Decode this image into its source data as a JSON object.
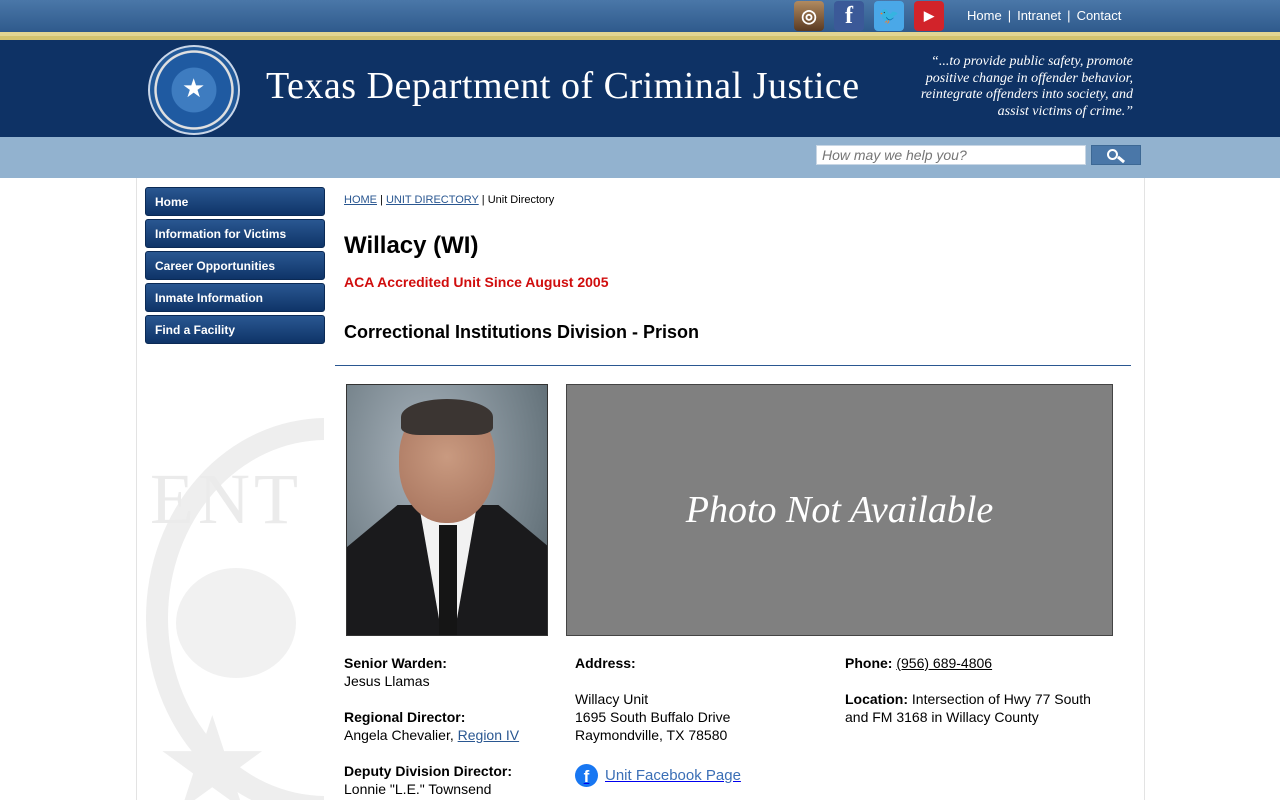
{
  "top": {
    "social": [
      {
        "name": "instagram-icon",
        "glyph": "◎"
      },
      {
        "name": "facebook-icon",
        "glyph": "f"
      },
      {
        "name": "twitter-icon",
        "glyph": "🐦"
      },
      {
        "name": "youtube-icon",
        "glyph": "▶"
      }
    ],
    "links": [
      "Home",
      "Intranet",
      "Contact"
    ]
  },
  "header": {
    "title": "Texas Department of Criminal Justice",
    "motto": "“...to provide public safety, promote positive change in offender behavior, reintegrate offenders into society, and assist victims of crime.”"
  },
  "search": {
    "placeholder": "How may we help you?"
  },
  "nav": [
    "Home",
    "Information for Victims",
    "Career Opportunities",
    "Inmate Information",
    "Find a Facility"
  ],
  "breadcrumb": {
    "home": "HOME",
    "directory": "UNIT DIRECTORY",
    "current": "Unit Directory"
  },
  "unit": {
    "name": "Willacy (WI)",
    "accreditation": "ACA Accredited Unit Since August 2005",
    "division": "Correctional Institutions Division - Prison",
    "photo_text": "Photo Not Available",
    "senior_warden_label": "Senior Warden:",
    "senior_warden": "Jesus Llamas",
    "regional_director_label": "Regional Director:",
    "regional_director": "Angela Chevalier,",
    "region_link": "Region IV",
    "deputy_label": "Deputy Division Director:",
    "deputy": "Lonnie \"L.E.\" Townsend",
    "address_label": "Address:",
    "address_line1": "Willacy Unit",
    "address_line2": "1695 South Buffalo Drive",
    "address_line3": "Raymondville, TX 78580",
    "facebook_link": "Unit Facebook Page",
    "phone_label": "Phone:",
    "phone": "(956) 689-4806",
    "location_label": "Location:",
    "location": "Intersection of Hwy 77 South and FM 3168 in Willacy County"
  },
  "colors": {
    "header_bg": "#0e3265",
    "nav_bg": "#1c4a82",
    "accent_red": "#d00d0d",
    "link_blue": "#2a5791"
  }
}
